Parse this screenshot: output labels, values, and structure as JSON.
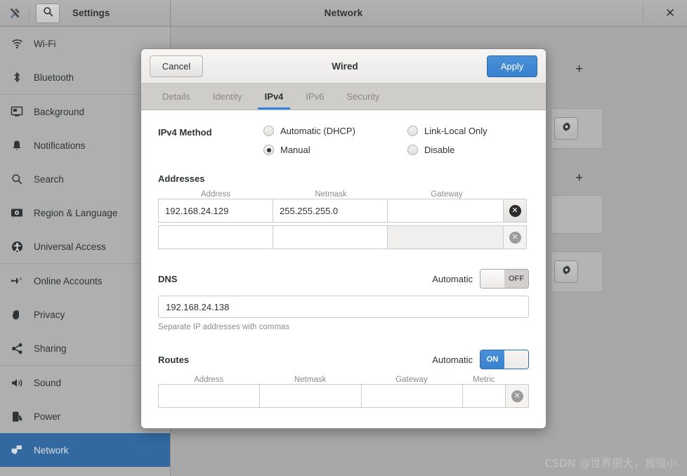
{
  "window": {
    "app_title": "Settings",
    "title": "Network",
    "tools_icon": "tools-icon",
    "search_icon": "search-icon",
    "close_icon": "close-icon"
  },
  "sidebar": {
    "items": [
      {
        "label": "Wi-Fi",
        "icon": "wifi-icon",
        "selected": false
      },
      {
        "label": "Bluetooth",
        "icon": "bluetooth-icon",
        "selected": false
      },
      {
        "label": "Background",
        "icon": "background-icon",
        "selected": false
      },
      {
        "label": "Notifications",
        "icon": "bell-icon",
        "selected": false
      },
      {
        "label": "Search",
        "icon": "search-icon",
        "selected": false
      },
      {
        "label": "Region & Language",
        "icon": "region-icon",
        "selected": false
      },
      {
        "label": "Universal Access",
        "icon": "accessibility-icon",
        "selected": false
      },
      {
        "label": "Online Accounts",
        "icon": "online-accounts-icon",
        "selected": false
      },
      {
        "label": "Privacy",
        "icon": "hand-icon",
        "selected": false
      },
      {
        "label": "Sharing",
        "icon": "share-icon",
        "selected": false
      },
      {
        "label": "Sound",
        "icon": "speaker-icon",
        "selected": false
      },
      {
        "label": "Power",
        "icon": "power-icon",
        "selected": false
      },
      {
        "label": "Network",
        "icon": "network-icon",
        "selected": true
      }
    ],
    "selected_color": "#3269a0"
  },
  "background_panel": {
    "add_icon": "plus-icon",
    "add_label": "+",
    "gear_icon": "gear-icon"
  },
  "dialog": {
    "cancel_label": "Cancel",
    "title": "Wired",
    "apply_label": "Apply",
    "apply_color": "#3a81ce",
    "tabs": [
      {
        "label": "Details",
        "active": false
      },
      {
        "label": "Identity",
        "active": false
      },
      {
        "label": "IPv4",
        "active": true
      },
      {
        "label": "IPv6",
        "active": false
      },
      {
        "label": "Security",
        "active": false
      }
    ],
    "ipv4": {
      "method_label": "IPv4 Method",
      "options": [
        {
          "label": "Automatic (DHCP)",
          "selected": false
        },
        {
          "label": "Link-Local Only",
          "selected": false
        },
        {
          "label": "Manual",
          "selected": true
        },
        {
          "label": "Disable",
          "selected": false
        }
      ],
      "addresses": {
        "title": "Addresses",
        "columns": [
          "Address",
          "Netmask",
          "Gateway"
        ],
        "rows": [
          {
            "address": "192.168.24.129",
            "netmask": "255.255.255.0",
            "gateway": "",
            "gateway_dim": false,
            "delete_enabled": true
          },
          {
            "address": "",
            "netmask": "",
            "gateway": "",
            "gateway_dim": true,
            "delete_enabled": false
          }
        ],
        "delete_icon": "delete-circle-icon"
      },
      "dns": {
        "title": "DNS",
        "automatic_label": "Automatic",
        "automatic_state": "OFF",
        "value": "192.168.24.138",
        "placeholder": "",
        "hint": "Separate IP addresses with commas"
      },
      "routes": {
        "title": "Routes",
        "automatic_label": "Automatic",
        "automatic_state": "ON",
        "columns": [
          "Address",
          "Netmask",
          "Gateway",
          "Metric"
        ],
        "rows": [
          {
            "address": "",
            "netmask": "",
            "gateway": "",
            "metric": "",
            "delete_enabled": false
          }
        ],
        "delete_icon": "delete-circle-icon"
      }
    }
  },
  "watermark": {
    "text": "CSDN @世界很大，我很小"
  }
}
